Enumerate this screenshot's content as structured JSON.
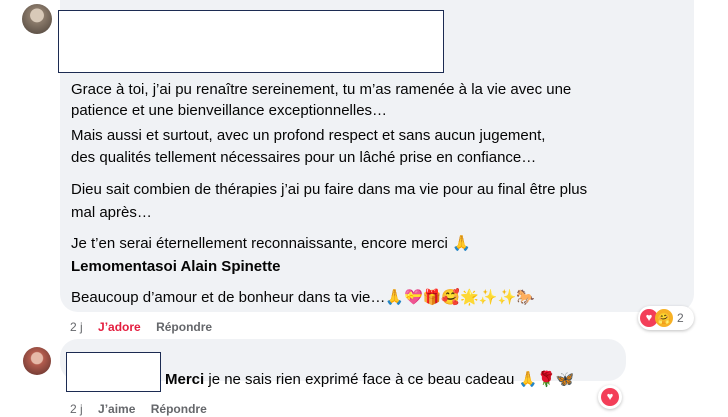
{
  "comment1": {
    "lines": [
      "Grace à toi, j’ai pu renaître sereinement, tu m’as ramenée à la vie avec une",
      "patience et une bienveillance exceptionnelles…",
      "Mais aussi et surtout, avec un profond respect et sans aucun jugement,",
      "des qualités tellement nécessaires pour un lâché prise en confiance…",
      "Dieu sait combien de thérapies j’ai pu faire dans ma vie pour au final être plus",
      "mal après…",
      "Je t’en serai éternellement reconnaissante, encore merci 🙏",
      "Lemomentasoi Alain Spinette",
      "Beaucoup d’amour et de bonheur dans ta vie…🙏💝🎁🥰🌟✨✨🐎"
    ],
    "time": "2 j",
    "like_label": "J’adore",
    "reply_label": "Répondre",
    "reaction_count": "2"
  },
  "comment2": {
    "bold_word": "Merci",
    "text": " je ne sais rien exprimé face à ce beau cadeau 🙏🌹🦋",
    "time": "2 j",
    "like_label": "J’aime",
    "reply_label": "Répondre"
  },
  "colors": {
    "bubble": "#f0f2f5",
    "love": "#e41e3f",
    "meta": "#65676b",
    "redaction_border": "#1c2b52"
  },
  "icons": [
    "love-reaction-icon",
    "care-reaction-icon"
  ]
}
